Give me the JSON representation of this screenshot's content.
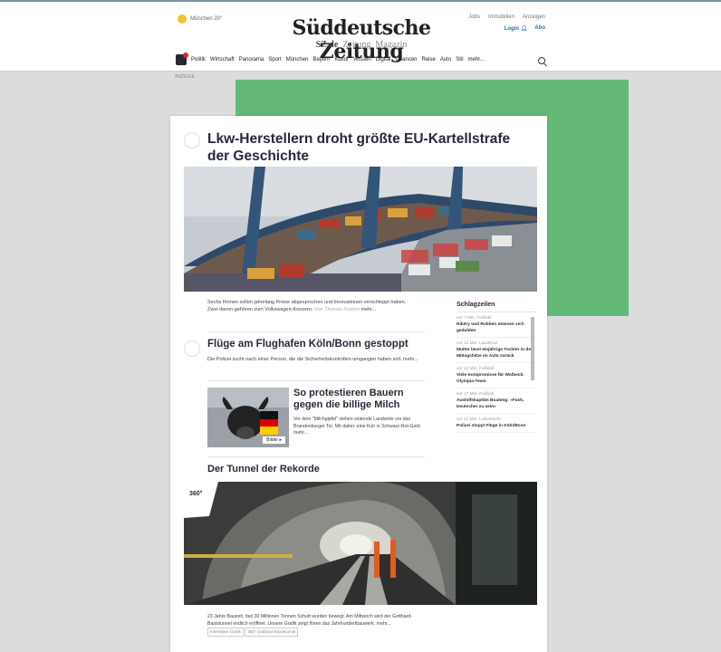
{
  "header": {
    "weather": "München 20°",
    "logo": "Süddeutsche Zeitung",
    "sub_prefix": "SZ.de",
    "sub_links": [
      "Zeitung",
      "Magazin"
    ],
    "top_links": [
      "Jobs",
      "Immobilien",
      "Anzeigen"
    ],
    "login": "Login",
    "abo": "Abo"
  },
  "nav": {
    "items": [
      "Politik",
      "Wirtschaft",
      "Panorama",
      "Sport",
      "München",
      "Bayern",
      "Kultur",
      "Wissen",
      "Digital",
      "Chancen",
      "Reise",
      "Auto",
      "Stil",
      "mehr..."
    ]
  },
  "ad_label": "ANZEIGE",
  "colors": {
    "ad_green": "#65b977",
    "text_dark": "#29293a",
    "link_blue": "#2a6fb0"
  },
  "lead": {
    "headline": "Lkw-Herstellern droht größte EU-Kartellstrafe der Geschichte",
    "teaser": "Sechs Firmen sollen jahrelang Preise abgesprochen und Innovationen verschleppt haben. Zwei davon gehören zum Volkswagen-Konzern.",
    "source": "Von Thomas Fromm",
    "more": "mehr..."
  },
  "article2": {
    "headline": "Flüge am Flughafen Köln/Bonn gestoppt",
    "teaser": "Die Polizei sucht nach einer Person, die die Sicherheitskontrollen umgangen haben soll.",
    "more": "mehr..."
  },
  "article3": {
    "headline": "So protestieren Bauern gegen die billige Milch",
    "teaser": "Vor dem \"Milchgipfel\" ziehen wütende Landwirte vor das Brandenburger Tor. Mit dabei: eine Kuh in Schwarz-Rot-Gold.",
    "more": "mehr...",
    "badge": "Bilder"
  },
  "article4": {
    "headline": "Der Tunnel der Rekorde",
    "badge": "360°",
    "teaser": "23 Jahre Bauzeit, fast 30 Millionen Tonnen Schutt wurden bewegt. Am Mittwoch wird der Gotthard-Basistunnel endlich eröffnet. Unsere Grafik zeigt Ihnen das Jahrhundertbauwerk.",
    "more": "mehr...",
    "tags": [
      "Interaktive Grafik",
      "360° Gotthard-Basistunnel"
    ]
  },
  "sidebar": {
    "title": "Schlagzeilen",
    "items": [
      {
        "time": "vor 7 Min.",
        "section": "Fußball",
        "headline": "Ribéry und Robben müssen sich gedulden"
      },
      {
        "time": "vor 12 Min.",
        "section": "Landshut",
        "headline": "Mutter lässt einjährige Tochter in der Mittagshitze im Auto zurück"
      },
      {
        "time": "vor 12 Min.",
        "section": "Fußball",
        "headline": "Viele Kompromisse für Wolbeck: Olympia-Team"
      },
      {
        "time": "vor 17 Min.",
        "section": "Fußball",
        "headline": "Aushilfskapitän Boateng: »Fash, Deutscher zu sein«"
      },
      {
        "time": "vor 21 Min.",
        "section": "Luftverkehr",
        "headline": "Polizei stoppt Flüge in Köln/Bonn"
      }
    ]
  }
}
